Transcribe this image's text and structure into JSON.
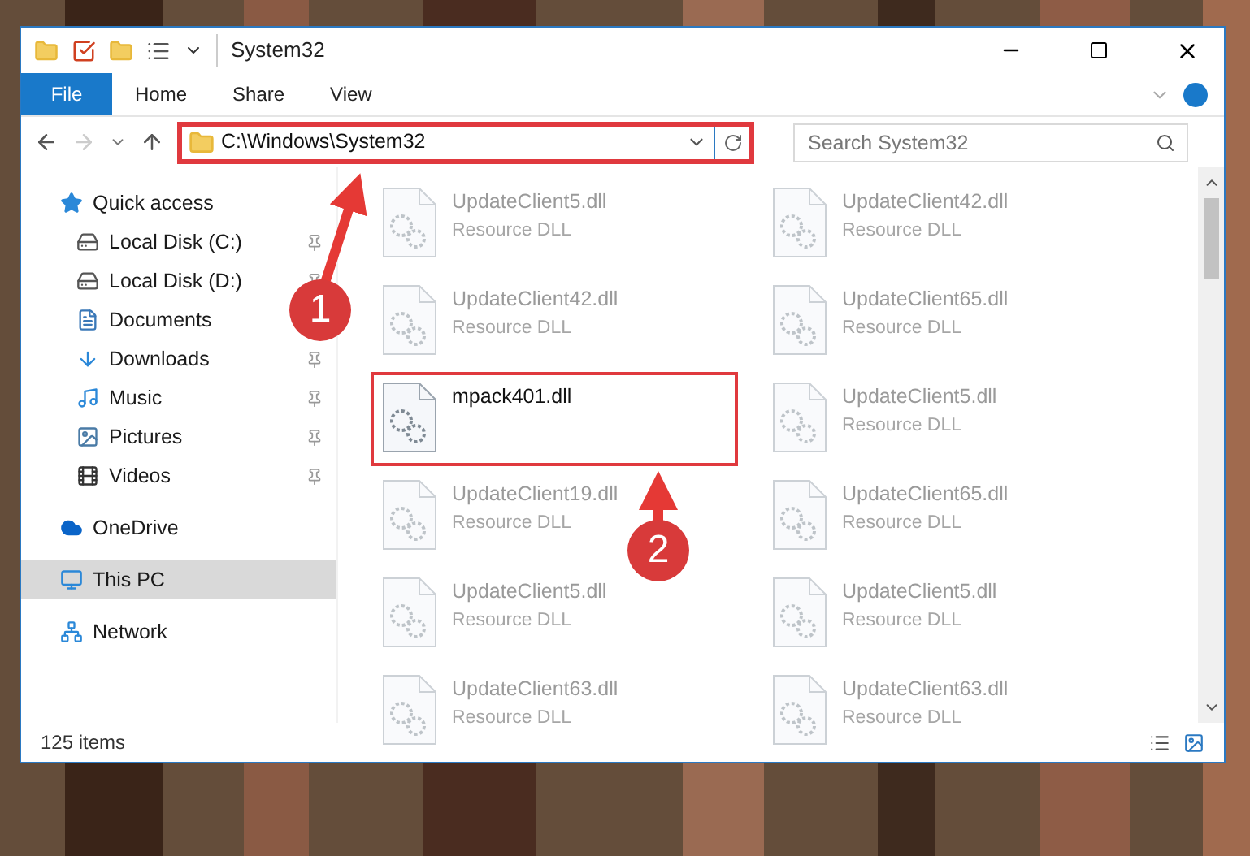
{
  "window": {
    "title": "System32"
  },
  "ribbon_tabs": [
    {
      "label": "File",
      "kind": "file"
    },
    {
      "label": "Home",
      "kind": "tab"
    },
    {
      "label": "Share",
      "kind": "tab"
    },
    {
      "label": "View",
      "kind": "tab"
    }
  ],
  "address_bar": {
    "path": "C:\\Windows\\System32",
    "highlighted": true
  },
  "search": {
    "placeholder": "Search System32"
  },
  "sidebar": {
    "items": [
      {
        "label": "Quick access",
        "selected": false,
        "pinned": false,
        "children": [
          {
            "label": "Local Disk (C:)",
            "selected": false,
            "pinned": true
          },
          {
            "label": "Local Disk (D:)",
            "selected": false,
            "pinned": true
          },
          {
            "label": "Documents",
            "selected": false,
            "pinned": false
          },
          {
            "label": "Downloads",
            "selected": false,
            "pinned": true
          },
          {
            "label": "Music",
            "selected": false,
            "pinned": true
          },
          {
            "label": "Pictures",
            "selected": false,
            "pinned": true
          },
          {
            "label": "Videos",
            "selected": false,
            "pinned": true
          }
        ]
      },
      {
        "label": "OneDrive",
        "selected": false,
        "pinned": false
      },
      {
        "label": "This PC",
        "selected": true,
        "pinned": false
      },
      {
        "label": "Network",
        "selected": false,
        "pinned": false
      }
    ]
  },
  "files": [
    {
      "name": "UpdateClient5.dll",
      "type": "Resource DLL",
      "selected": false
    },
    {
      "name": "UpdateClient42.dll",
      "type": "Resource DLL",
      "selected": false
    },
    {
      "name": "UpdateClient42.dll",
      "type": "Resource DLL",
      "selected": false
    },
    {
      "name": "UpdateClient65.dll",
      "type": "Resource DLL",
      "selected": false
    },
    {
      "name": "mpack401.dll",
      "selected": true
    },
    {
      "name": "UpdateClient5.dll",
      "type": "Resource DLL",
      "selected": false
    },
    {
      "name": "UpdateClient19.dll",
      "type": "Resource DLL",
      "selected": false
    },
    {
      "name": "UpdateClient65.dll",
      "type": "Resource DLL",
      "selected": false
    },
    {
      "name": "UpdateClient5.dll",
      "type": "Resource DLL",
      "selected": false
    },
    {
      "name": "UpdateClient5.dll",
      "type": "Resource DLL",
      "selected": false
    },
    {
      "name": "UpdateClient63.dll",
      "type": "Resource DLL",
      "selected": false
    },
    {
      "name": "UpdateClient63.dll",
      "type": "Resource DLL",
      "selected": false
    }
  ],
  "status_bar": {
    "item_count": "125 items"
  },
  "annotations": [
    {
      "label": "1"
    },
    {
      "label": "2"
    }
  ]
}
